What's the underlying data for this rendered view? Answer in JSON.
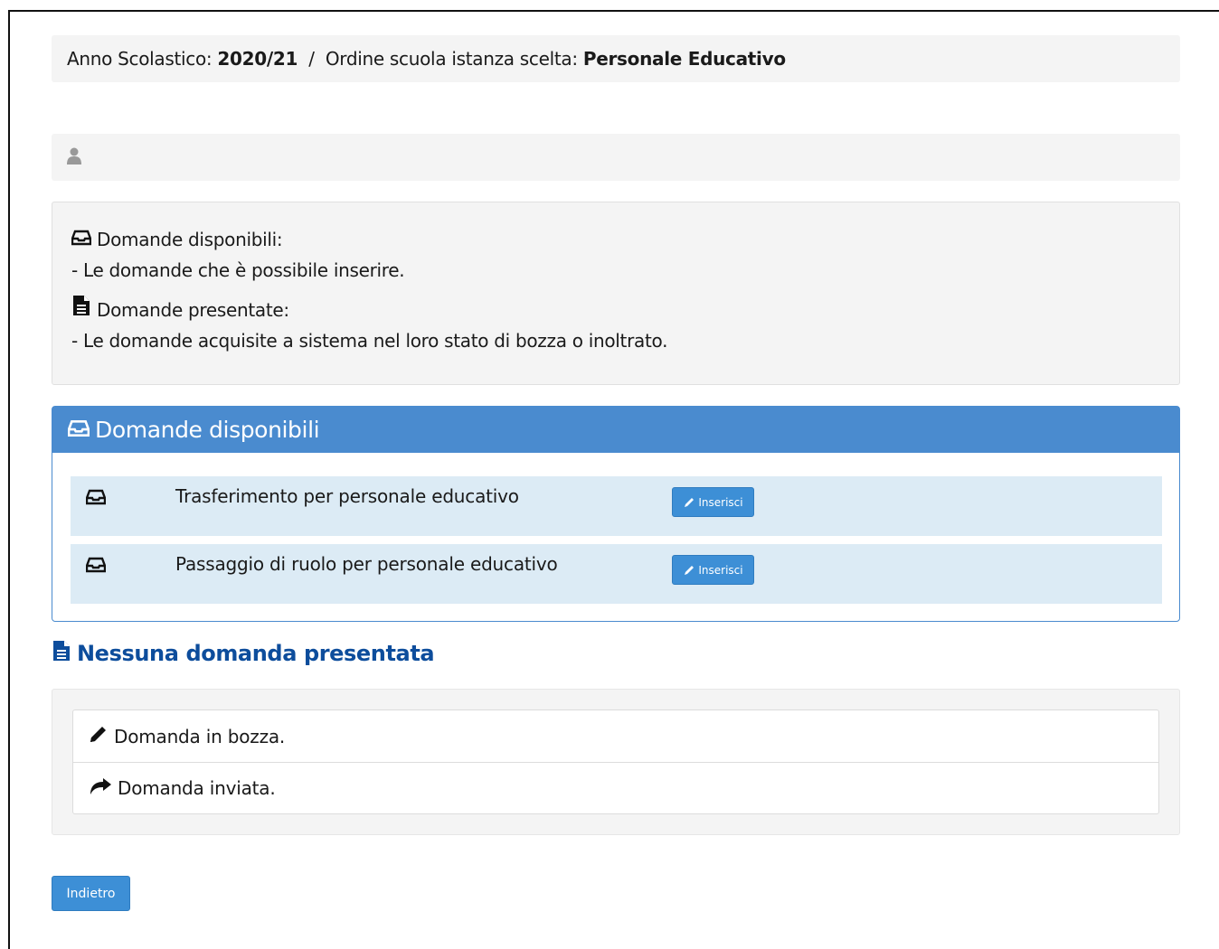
{
  "breadcrumb": {
    "year_label": "Anno Scolastico:",
    "year_value": "2020/21",
    "separator": "/",
    "order_label": "Ordine scuola istanza scelta:",
    "order_value": "Personale Educativo"
  },
  "user_bar": {
    "icon": "user-icon"
  },
  "legend": {
    "available_title": "Domande disponibili:",
    "available_desc": "- Le domande che è possibile inserire.",
    "submitted_title": "Domande presentate:",
    "submitted_desc": "- Le domande acquisite a sistema nel loro stato di bozza o inoltrato."
  },
  "available_panel": {
    "title": "Domande disponibili",
    "rows": [
      {
        "label": "Trasferimento per personale educativo",
        "button": "Inserisci"
      },
      {
        "label": "Passaggio di ruolo per personale educativo",
        "button": "Inserisci"
      }
    ]
  },
  "submitted": {
    "title": "Nessuna domanda presentata",
    "statuses": [
      {
        "icon": "pencil-icon",
        "label": "Domanda in bozza."
      },
      {
        "icon": "share-icon",
        "label": "Domanda inviata."
      }
    ]
  },
  "back_button": "Indietro",
  "colors": {
    "primary": "#4a8bcf",
    "button": "#3d8fd6",
    "row_bg": "#dcebf5",
    "title_blue": "#0d4d9c",
    "bar_bg": "#f4f4f4"
  }
}
